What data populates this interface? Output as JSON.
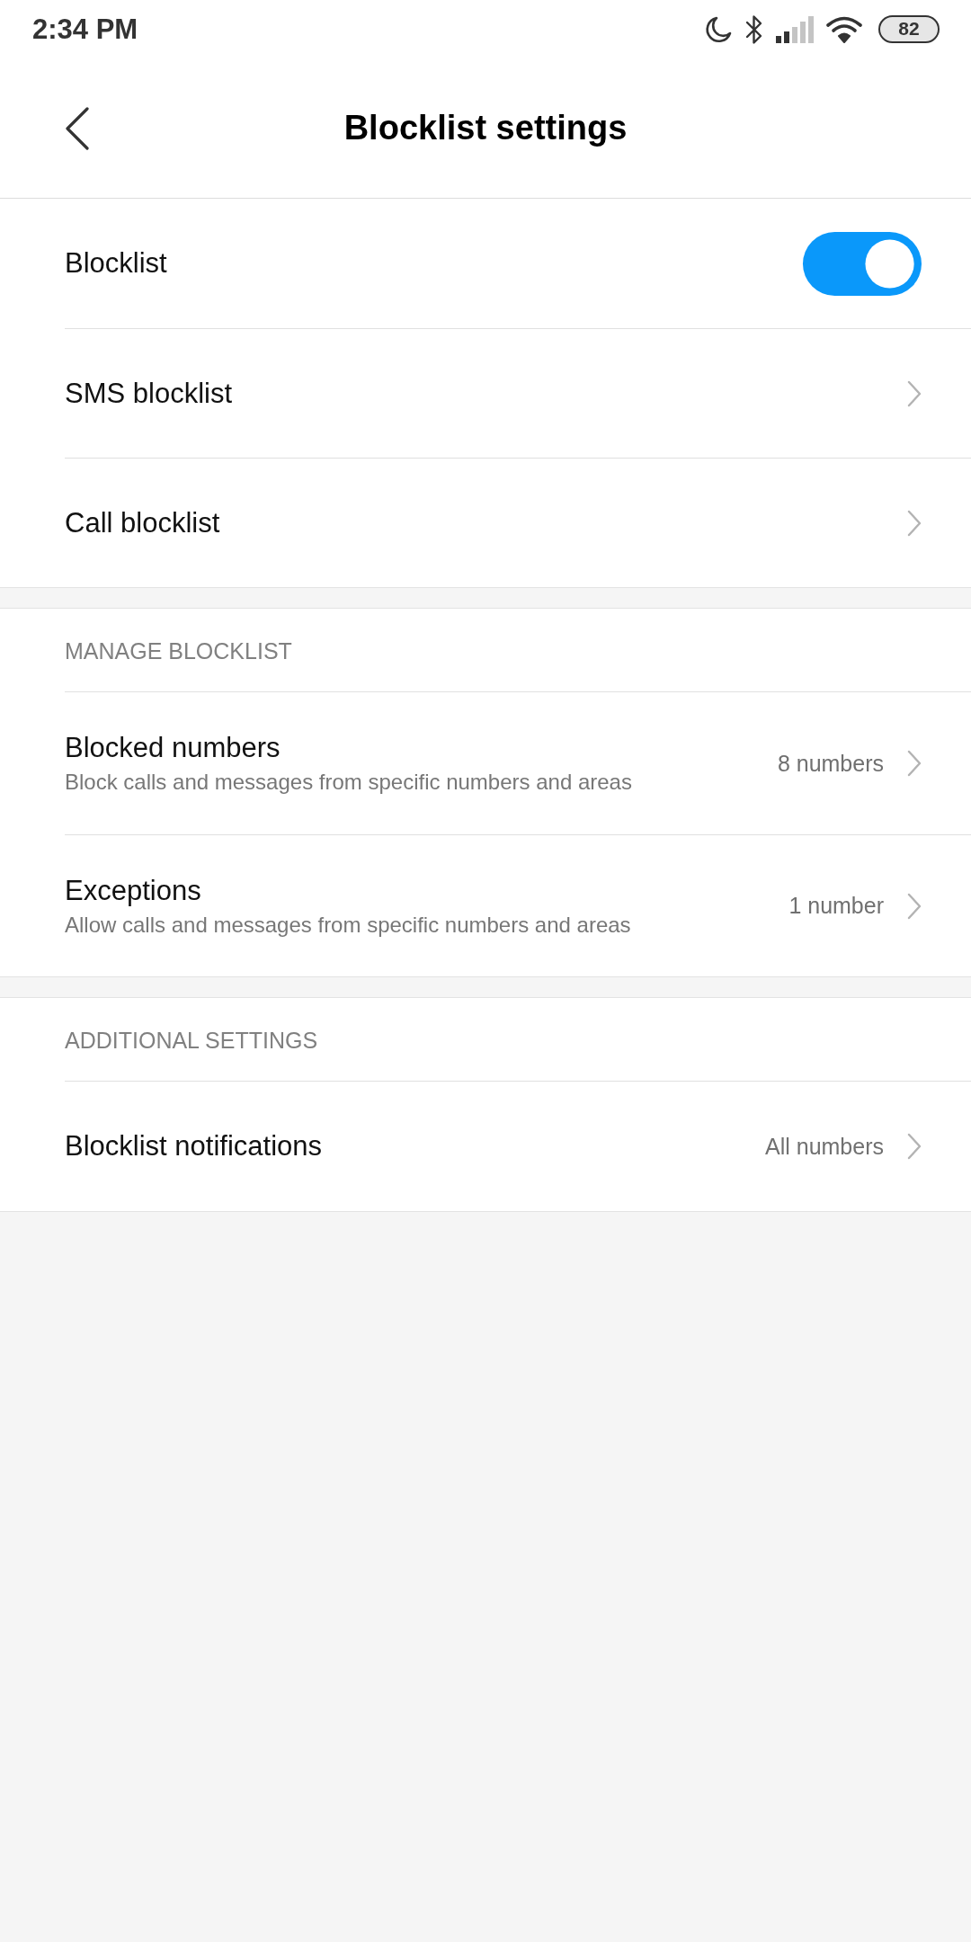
{
  "status_bar": {
    "time": "2:34 PM",
    "battery": "82"
  },
  "header": {
    "title": "Blocklist settings"
  },
  "sections": [
    {
      "items": [
        {
          "kind": "toggle",
          "label": "Blocklist",
          "on": true
        },
        {
          "kind": "link",
          "label": "SMS blocklist"
        },
        {
          "kind": "link",
          "label": "Call blocklist"
        }
      ]
    },
    {
      "title": "MANAGE BLOCKLIST",
      "items": [
        {
          "kind": "link",
          "label": "Blocked numbers",
          "description": "Block calls and messages from specific numbers and areas",
          "value": "8 numbers"
        },
        {
          "kind": "link",
          "label": "Exceptions",
          "description": "Allow calls and messages from specific numbers and areas",
          "value": "1 number"
        }
      ]
    },
    {
      "title": "ADDITIONAL SETTINGS",
      "items": [
        {
          "kind": "link",
          "label": "Blocklist notifications",
          "value": "All numbers"
        }
      ]
    }
  ]
}
